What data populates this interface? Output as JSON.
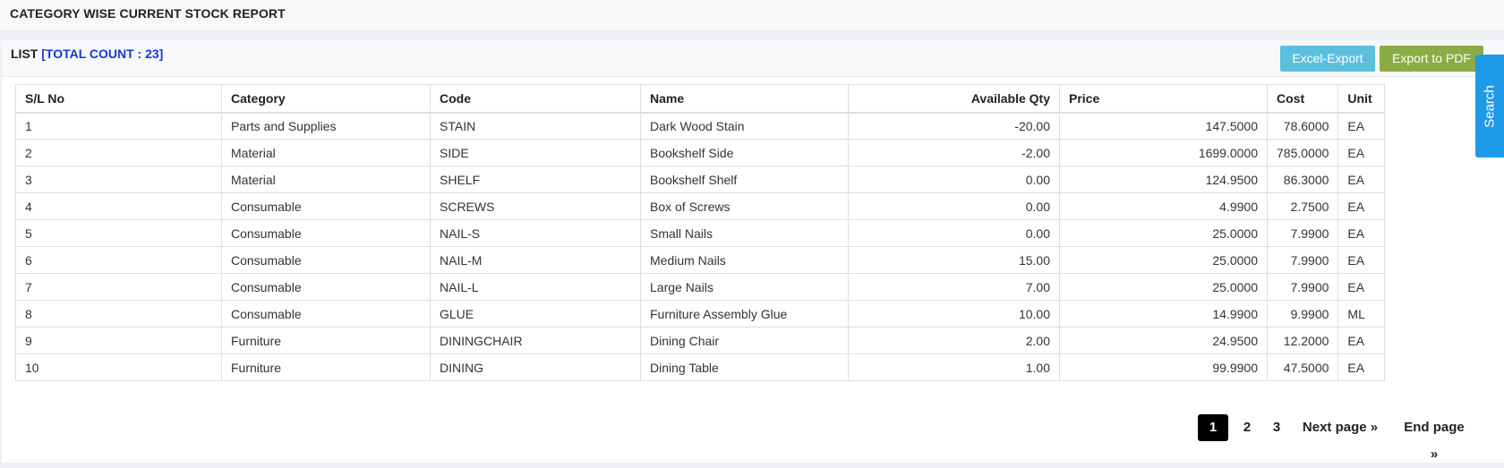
{
  "page": {
    "title": "CATEGORY WISE CURRENT STOCK REPORT"
  },
  "list": {
    "label": "LIST",
    "total_count_text": "[TOTAL COUNT : 23]",
    "buttons": {
      "excel": "Excel-Export",
      "pdf": "Export to PDF"
    }
  },
  "search_tab": "Search",
  "table": {
    "headers": [
      "S/L No",
      "Category",
      "Code",
      "Name",
      "Available Qty",
      "Price",
      "Cost",
      "Unit"
    ],
    "rows": [
      [
        "1",
        "Parts and Supplies",
        "STAIN",
        "Dark Wood Stain",
        "-20.00",
        "147.5000",
        "78.6000",
        "EA"
      ],
      [
        "2",
        "Material",
        "SIDE",
        "Bookshelf Side",
        "-2.00",
        "1699.0000",
        "785.0000",
        "EA"
      ],
      [
        "3",
        "Material",
        "SHELF",
        "Bookshelf Shelf",
        "0.00",
        "124.9500",
        "86.3000",
        "EA"
      ],
      [
        "4",
        "Consumable",
        "SCREWS",
        "Box of Screws",
        "0.00",
        "4.9900",
        "2.7500",
        "EA"
      ],
      [
        "5",
        "Consumable",
        "NAIL-S",
        "Small Nails",
        "0.00",
        "25.0000",
        "7.9900",
        "EA"
      ],
      [
        "6",
        "Consumable",
        "NAIL-M",
        "Medium Nails",
        "15.00",
        "25.0000",
        "7.9900",
        "EA"
      ],
      [
        "7",
        "Consumable",
        "NAIL-L",
        "Large Nails",
        "7.00",
        "25.0000",
        "7.9900",
        "EA"
      ],
      [
        "8",
        "Consumable",
        "GLUE",
        "Furniture Assembly Glue",
        "10.00",
        "14.9900",
        "9.9900",
        "ML"
      ],
      [
        "9",
        "Furniture",
        "DININGCHAIR",
        "Dining Chair",
        "2.00",
        "24.9500",
        "12.2000",
        "EA"
      ],
      [
        "10",
        "Furniture",
        "DINING",
        "Dining Table",
        "1.00",
        "99.9900",
        "47.5000",
        "EA"
      ]
    ]
  },
  "pagination": {
    "pages": [
      "1",
      "2",
      "3"
    ],
    "active": "1",
    "next": "Next page »",
    "end": "End page »"
  },
  "colors": {
    "count_text": "#1a35d6",
    "excel_button": "#5bc0de",
    "pdf_button": "#8aac45",
    "search_tab": "#1e9be8",
    "active_page": "#000000"
  }
}
